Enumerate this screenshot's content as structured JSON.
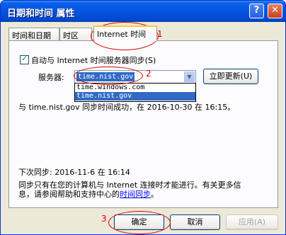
{
  "window": {
    "title": "日期和时间 属性"
  },
  "titlebar": {
    "help_glyph": "?",
    "close_glyph": "✕"
  },
  "tabs": [
    {
      "label": "时间和日期"
    },
    {
      "label": "时区"
    },
    {
      "label": "Internet 时间"
    }
  ],
  "sync": {
    "checkbox_label": "自动与 Internet 时间服务器同步(S)",
    "checked": true,
    "server_label": "服务器:",
    "server_value": "time.nist.gov",
    "options": [
      "time.windows.com",
      "time.nist.gov"
    ],
    "update_button": "立即更新(U)",
    "status": "与 time.nist.gov 同步时间成功，在 2016-10-30 在 16:15。",
    "next_sync": "下次同步: 2016-11-6 在 16:14",
    "info_line1": "同步只有在您的计算机与 Internet 连接时才能进行。有关更多信",
    "info_line2_prefix": "息，请参阅帮助和支持中心的",
    "info_link": "时间同步",
    "info_line2_suffix": "。"
  },
  "buttons": {
    "ok": "确定",
    "cancel": "取消",
    "apply": "应用(A)"
  },
  "annotations": {
    "one": "1",
    "two": "2",
    "three": "3"
  },
  "colors": {
    "titlebar": "#0553de",
    "accent": "#316ac5",
    "annotation": "#e00000"
  }
}
